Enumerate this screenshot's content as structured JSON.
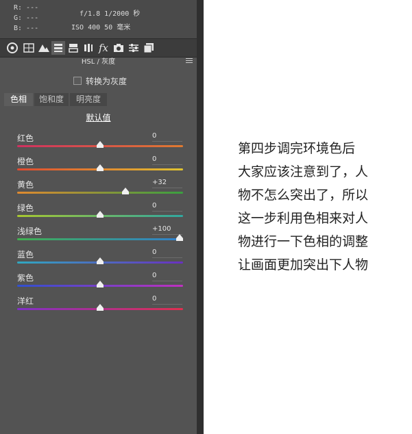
{
  "info": {
    "r": "R: ---",
    "g": "G: ---",
    "b": "B: ---",
    "aperture_shutter": "f/1.8  1/2000 秒",
    "iso_focal": "ISO 400  50 毫米"
  },
  "toolbar": {
    "icons": [
      "aperture-icon",
      "grid-icon",
      "mountain-icon",
      "hsl-icon",
      "split-toning-icon",
      "lens-icon",
      "fx-icon",
      "camera-icon",
      "sliders-icon",
      "presets-icon"
    ]
  },
  "panel": {
    "header": "HSL / 灰度",
    "convert_gray_label": "转换为灰度",
    "convert_gray_checked": false,
    "tabs": [
      "色相",
      "饱和度",
      "明亮度"
    ],
    "active_tab": "色相",
    "default_link": "默认值",
    "sliders": [
      {
        "label": "红色",
        "value": "0",
        "fraction": 0.5,
        "gradient": [
          "#d03060",
          "#e07a30"
        ]
      },
      {
        "label": "橙色",
        "value": "0",
        "fraction": 0.5,
        "gradient": [
          "#e04a30",
          "#e0c430"
        ]
      },
      {
        "label": "黄色",
        "value": "+32",
        "fraction": 0.66,
        "gradient": [
          "#e08a30",
          "#3aa040"
        ]
      },
      {
        "label": "绿色",
        "value": "0",
        "fraction": 0.5,
        "gradient": [
          "#a8c830",
          "#30a8a0"
        ]
      },
      {
        "label": "浅绿色",
        "value": "+100",
        "fraction": 1.0,
        "gradient": [
          "#40b050",
          "#3080d0"
        ]
      },
      {
        "label": "蓝色",
        "value": "0",
        "fraction": 0.5,
        "gradient": [
          "#30a8c0",
          "#6a30c0"
        ]
      },
      {
        "label": "紫色",
        "value": "0",
        "fraction": 0.5,
        "gradient": [
          "#3050d0",
          "#c030c0"
        ]
      },
      {
        "label": "洋红",
        "value": "0",
        "fraction": 0.5,
        "gradient": [
          "#8030c8",
          "#e03050"
        ]
      }
    ]
  },
  "annotation": {
    "lines": [
      "第四步调完环境色后",
      "大家应该注意到了，人",
      "物不怎么突出了，所以",
      "这一步利用色相来对人",
      "物进行一下色相的调整",
      "让画面更加突出下人物"
    ]
  }
}
